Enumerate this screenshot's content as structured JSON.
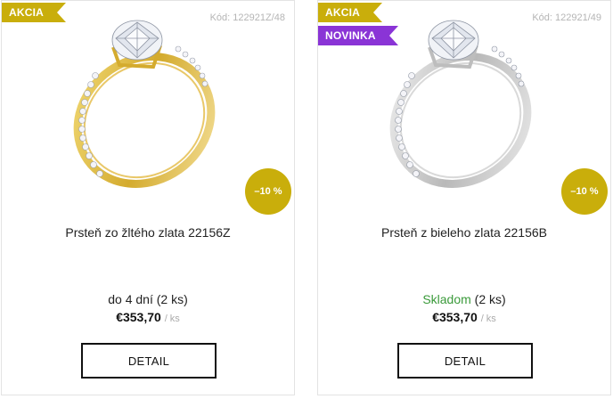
{
  "products": [
    {
      "flags": [
        "AKCIA"
      ],
      "code": "Kód: 122921Z/48",
      "name": "Prsteň zo žltého zlata 22156Z",
      "discount": "–10 %",
      "availability_status": "do 4 dní",
      "availability_qty": " (2 ks)",
      "price": "€353,70",
      "price_unit": "/ ks",
      "button_label": "DETAIL",
      "metal_color": "#d9b540"
    },
    {
      "flags": [
        "AKCIA",
        "NOVINKA"
      ],
      "code": "Kód: 122921/49",
      "name": "Prsteň z bieleho zlata 22156B",
      "discount": "–10 %",
      "availability_status": "Skladom",
      "availability_qty": " (2 ks)",
      "price": "€353,70",
      "price_unit": "/ ks",
      "button_label": "DETAIL",
      "metal_color": "#c8c8c8"
    }
  ],
  "colors": {
    "sale_flag": "#c9ae0b",
    "new_flag": "#8a34d6",
    "in_stock": "#3a9a3a",
    "discount_badge": "#c9ae0b"
  }
}
